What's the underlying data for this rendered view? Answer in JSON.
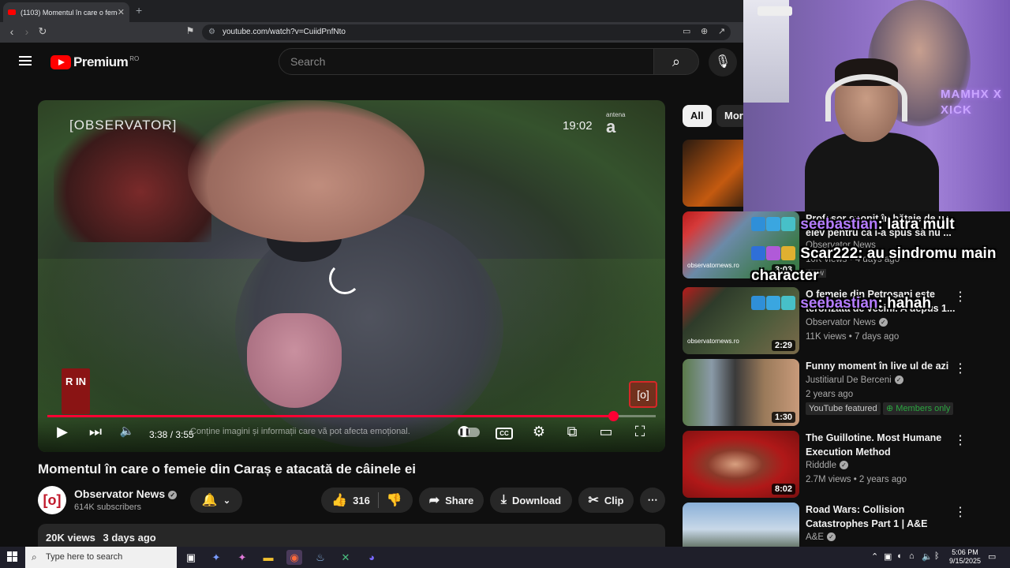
{
  "browser": {
    "tab_title": "(1103) Momentul în care o feme",
    "url": "youtube.com/watch?v=CuiidPnfNto"
  },
  "header": {
    "logo_text": "Premium",
    "region": "RO",
    "search_placeholder": "Search"
  },
  "player": {
    "channel_logo_text": "[OBSERVATOR]",
    "clock": "19:02",
    "network_logo": "antena",
    "time_current": "3:38",
    "time_separator": " / ",
    "time_total": "3:55",
    "warning_text": "Conține imagini și informații care vă pot afecta emoțional.",
    "progress_fraction": 0.93,
    "badge_left": "R IN",
    "badge_right": "[o]",
    "cc_label": "CC"
  },
  "video": {
    "title": "Momentul în care o femeie din Caraș e atacată de câinele ei",
    "channel": "Observator News",
    "channel_avatar": "[o]",
    "subscribers": "614K subscribers",
    "likes": "316",
    "share_label": "Share",
    "download_label": "Download",
    "clip_label": "Clip",
    "views": "20K views",
    "age": "3 days ago"
  },
  "sidebar": {
    "chips": [
      "All",
      "Mor"
    ],
    "items": [
      {
        "title": "Profesor snopit în bătaie de un elev pentru că i-a spus să nu ...",
        "channel": "Observator News",
        "meta": "10K views • 4 days ago",
        "duration": "3:03",
        "thumb_text": "observatornews.ro",
        "badge": "New"
      },
      {
        "title": "O femeie din Petroșani este terorizată de vecini. A depus 1...",
        "channel": "Observator News",
        "meta": "11K views • 7 days ago",
        "duration": "2:29",
        "thumb_text": "observatornews.ro"
      },
      {
        "title": "Funny moment în live ul de azi",
        "channel": "Justitiarul De Berceni",
        "meta": "2 years ago",
        "duration": "1:30",
        "badge": "YouTube featured",
        "badge2": "Members only"
      },
      {
        "title": "The Guillotine. Most Humane Execution Method",
        "channel": "Ridddle",
        "meta": "2.7M views • 2 years ago",
        "duration": "8:02"
      },
      {
        "title": "Road Wars: Collision Catastrophes Part 1 | A&E",
        "channel": "A&E",
        "meta": ""
      }
    ]
  },
  "webcam": {
    "neon_text": "MAMHX X XICK"
  },
  "chat": [
    {
      "user": "seebastian",
      "message": ": latra mult"
    },
    {
      "user": "Scar222",
      "message": ": au sindromu main"
    },
    {
      "user": "",
      "message": "character"
    },
    {
      "user": "seebastian",
      "message": ": hahah"
    }
  ],
  "taskbar": {
    "search_placeholder": "Type here to search",
    "time": "5:06 PM",
    "date": "9/15/2025"
  },
  "colors": {
    "accent": "#ff0033",
    "background": "#0f0f0f",
    "chat_username": "#b47cff",
    "members_green": "#2ba640"
  }
}
